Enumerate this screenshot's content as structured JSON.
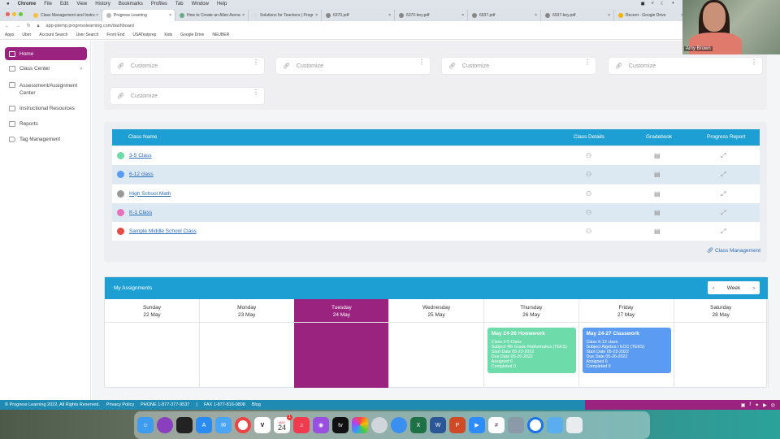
{
  "menubar": {
    "items": [
      "Chrome",
      "File",
      "Edit",
      "View",
      "History",
      "Bookmarks",
      "Profiles",
      "Tab",
      "Window",
      "Help"
    ]
  },
  "tabs": [
    {
      "label": "Class Management and Instru"
    },
    {
      "label": "Progress Learning",
      "active": true
    },
    {
      "label": "How to Create an Allen Arena"
    },
    {
      "label": "Solutions for Teachers | Progr"
    },
    {
      "label": "6370.pdf"
    },
    {
      "label": "6370-key.pdf"
    },
    {
      "label": "6937.pdf"
    },
    {
      "label": "6937-key.pdf"
    },
    {
      "label": "Recent - Google Drive"
    }
  ],
  "address": "app-ptemp.progresslearning.com/dashboard",
  "bookmarks": [
    "Apps",
    "Uber",
    "Account Search",
    "User Search",
    "Front End",
    "USATestprep",
    "Kids",
    "Google Drive",
    "NEUBER"
  ],
  "webcam": {
    "name": "Amy Brown"
  },
  "sidebar": {
    "items": [
      {
        "label": "Home",
        "active": true
      },
      {
        "label": "Class Center"
      },
      {
        "label": "Assessment/Assignment Center"
      },
      {
        "label": "Instructional Resources"
      },
      {
        "label": "Reports"
      },
      {
        "label": "Tag Management"
      }
    ]
  },
  "quicklinks": [
    "Customize",
    "Customize",
    "Customize",
    "Customize",
    "Customize"
  ],
  "classes": {
    "headers": {
      "name": "Class Name",
      "details": "Class Details",
      "gradebook": "Gradebook",
      "progress": "Progress Report"
    },
    "rows": [
      {
        "name": "3-5 Class",
        "color": "#6fdba8"
      },
      {
        "name": "6-12 class",
        "color": "#5b9cf2"
      },
      {
        "name": "High School Math",
        "color": "#999999"
      },
      {
        "name": "K-1 Class",
        "color": "#e86fb8"
      },
      {
        "name": "Sample Middle School Class",
        "color": "#e84848"
      }
    ],
    "management_link": "Class Management"
  },
  "assignments": {
    "title": "My Assignments",
    "week_label": "Week",
    "days": [
      {
        "name": "Sunday",
        "date": "22 May"
      },
      {
        "name": "Monday",
        "date": "23 May"
      },
      {
        "name": "Tuesday",
        "date": "24 May",
        "today": true
      },
      {
        "name": "Wednesday",
        "date": "25 May"
      },
      {
        "name": "Thursday",
        "date": "26 May"
      },
      {
        "name": "Friday",
        "date": "27 May"
      },
      {
        "name": "Saturday",
        "date": "28 May"
      }
    ],
    "cards": [
      {
        "day": 4,
        "color": "#6ddbaa",
        "title": "May 24-26 Homework",
        "lines": [
          "Class 3-5 Class",
          "Subject 4th Grade Mathematics (TEKS)",
          "Start Date 05-23-2022",
          "Due Date 05-26-2022",
          "Assigned 6",
          "Completed 0"
        ]
      },
      {
        "day": 5,
        "color": "#5b9cf2",
        "title": "May 24-27 Classwork",
        "lines": [
          "Class 6-12 class",
          "Subject Algebra I EOC (TEKS)",
          "Start Date 05-23-2022",
          "Due Date 05-26-2022",
          "Assigned 6",
          "Completed 0"
        ]
      }
    ]
  },
  "footer": {
    "copyright": "© Progress Learning 2022, All Rights Reserved.",
    "privacy": "Privacy Policy",
    "phone": "PHONE 1-877-377-9537",
    "sep": "|",
    "fax": "FAX 1-877-816-0808",
    "blog": "Blog"
  },
  "dock": {
    "calendar_month": "MAY",
    "calendar_day": "24",
    "badge": "1"
  },
  "colors": {
    "brand_purple": "#9b2380",
    "header_blue": "#1e9fd4"
  }
}
